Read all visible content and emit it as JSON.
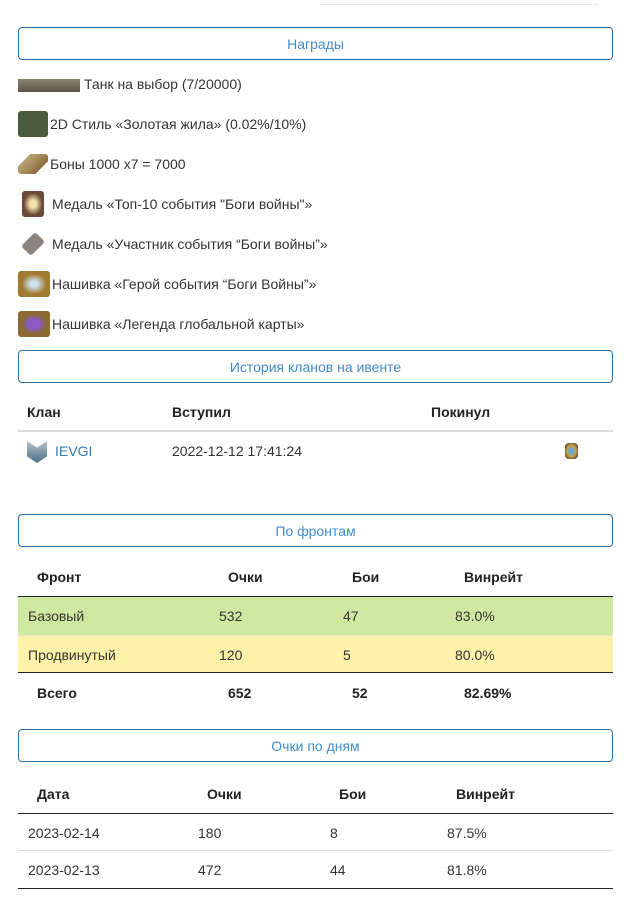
{
  "rewards_button": "Награды",
  "rewards": [
    {
      "icon": "tank-icon",
      "label": "Танк на выбор (7/20000)"
    },
    {
      "icon": "style-chest-icon",
      "label": "2D Стиль «Золотая жила» (0.02%/10%)"
    },
    {
      "icon": "bonds-icon",
      "label": "Боны 1000 x7 = 7000"
    },
    {
      "icon": "medal-top10-icon",
      "label": "Медаль «Топ-10 события \"Боги войны\"»"
    },
    {
      "icon": "medal-participant-icon",
      "label": "Медаль «Участник события “Боги войны”»"
    },
    {
      "icon": "patch-hero-icon",
      "label": "Нашивка «Герой события “Боги Войны”»"
    },
    {
      "icon": "patch-legend-icon",
      "label": "Нашивка «Легенда глобальной карты»"
    }
  ],
  "clan_history": {
    "button": "История кланов на ивенте",
    "headers": [
      "Клан",
      "Вступил",
      "Покинул"
    ],
    "rows": [
      {
        "clan": "IEVGI",
        "joined": "2022-12-12 17:41:24",
        "left": ""
      }
    ]
  },
  "fronts": {
    "button": "По фронтам",
    "headers": [
      "Фронт",
      "Очки",
      "Бои",
      "Винрейт"
    ],
    "rows": [
      [
        "Базовый",
        "532",
        "47",
        "83.0%"
      ],
      [
        "Продвинутый",
        "120",
        "5",
        "80.0%"
      ]
    ],
    "total": [
      "Всего",
      "652",
      "52",
      "82.69%"
    ],
    "colors": {
      "basic": "#d0e9a1",
      "advanced": "#fdf2a8"
    }
  },
  "days": {
    "button": "Очки по дням",
    "headers": [
      "Дата",
      "Очки",
      "Бои",
      "Винрейт"
    ],
    "rows": [
      [
        "2023-02-14",
        "180",
        "8",
        "87.5%"
      ],
      [
        "2023-02-13",
        "472",
        "44",
        "81.8%"
      ]
    ]
  }
}
